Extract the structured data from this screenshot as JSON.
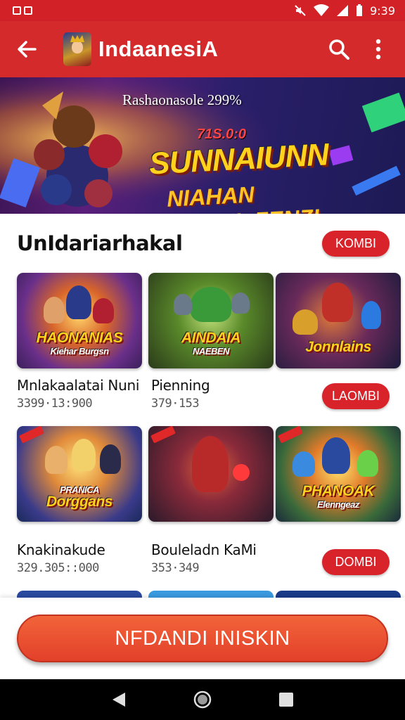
{
  "status": {
    "time": "9:39"
  },
  "app_bar": {
    "title": "IndaanesiA"
  },
  "banner": {
    "subtitle": "Rashaonasole 299%",
    "small_line": "71S.0:0",
    "headline": "SUNNAIUNN",
    "tagline": "NIAHAN BISHIIL.FENZI"
  },
  "section": {
    "title": "UnIdariarhakal",
    "button_label": "KOMBI"
  },
  "rows": [
    {
      "button_label": "LAOMBI",
      "cards": [
        {
          "art_label": "HAONANIAS",
          "art_sub": "Kiehar Burgsn"
        },
        {
          "art_label": "AINDAIA",
          "art_sub": "NAEBEN"
        },
        {
          "art_label": "Jonnlains",
          "art_sub": ""
        }
      ],
      "items": [
        {
          "title": "Mnlakaalatai Nuni",
          "meta": "3399·13:900"
        },
        {
          "title": "Pienning",
          "meta": "379·153"
        }
      ]
    },
    {
      "button_label": "DOMBI",
      "cards": [
        {
          "art_label": "Dorggans",
          "art_sub": "PRANICA"
        },
        {
          "art_label": "",
          "art_sub": ""
        },
        {
          "art_label": "PHANOAK",
          "art_sub": "Elenngeaz"
        }
      ],
      "items": [
        {
          "title": "Knakinakude",
          "meta": "329.305::000"
        },
        {
          "title": "Bouleladn KaMi",
          "meta": "353·349"
        }
      ]
    }
  ],
  "cta": {
    "label": "NFDANDI INISKIN"
  },
  "colors": {
    "primary": "#d42a2b",
    "cta": "#e8502f",
    "nav": "#000000"
  },
  "icons": [
    "back-arrow-icon",
    "search-icon",
    "more-vert-icon",
    "nav-back-icon",
    "nav-home-icon",
    "nav-recents-icon"
  ]
}
